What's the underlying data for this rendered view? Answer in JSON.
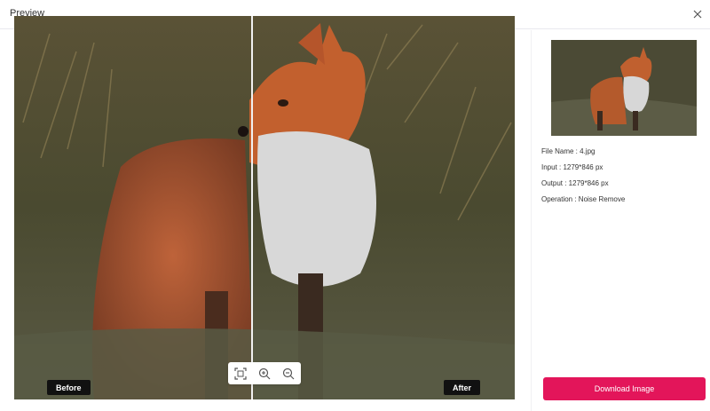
{
  "header": {
    "title": "Preview"
  },
  "compare": {
    "before_label": "Before",
    "after_label": "After"
  },
  "info": {
    "file_name": "File Name : 4.jpg",
    "input": "Input : 1279*846 px",
    "output": "Output : 1279*846 px",
    "operation": "Operation : Noise Remove"
  },
  "actions": {
    "download_label": "Download Image"
  },
  "icons": {
    "close": "close-icon",
    "fit": "fit-screen-icon",
    "zoom_in": "zoom-in-icon",
    "zoom_out": "zoom-out-icon"
  },
  "colors": {
    "accent": "#e3155a"
  }
}
